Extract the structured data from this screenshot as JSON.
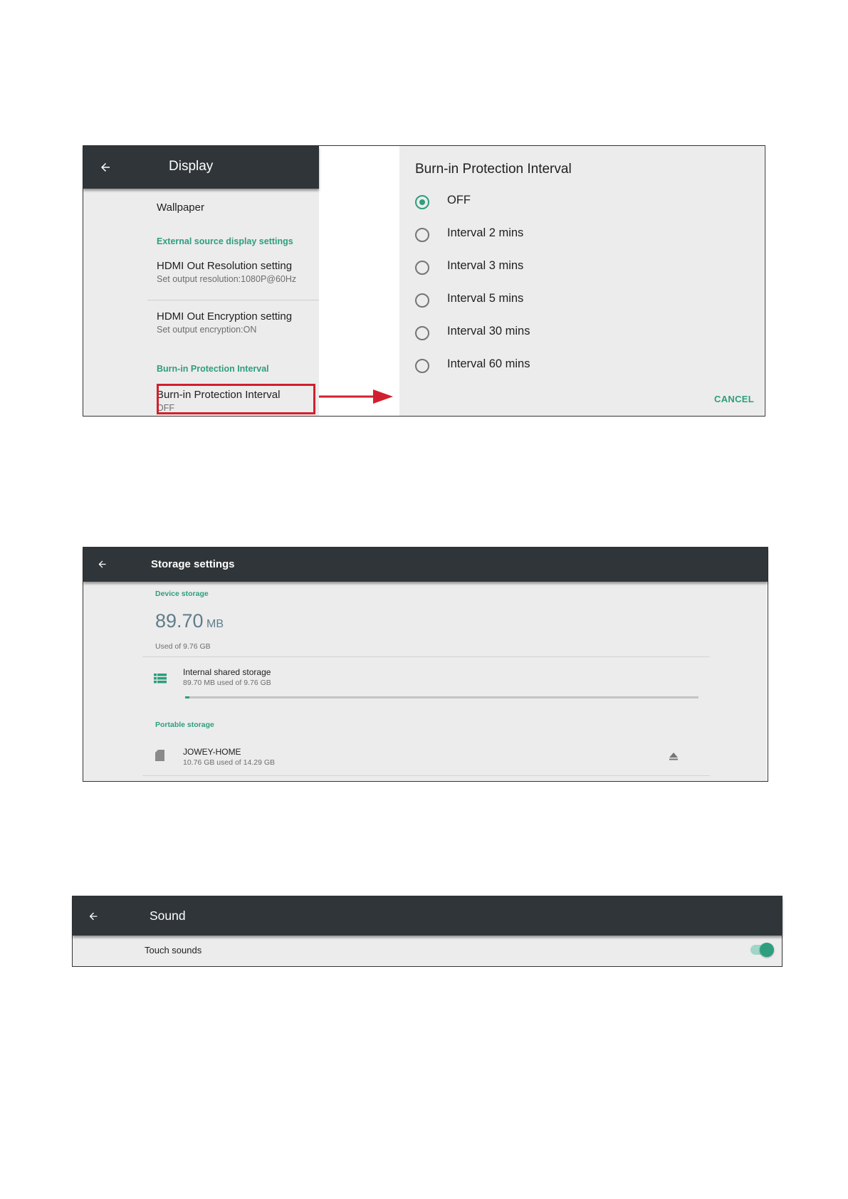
{
  "display": {
    "title": "Display",
    "wallpaper": "Wallpaper",
    "external_category": "External source display settings",
    "hdmi_res_title": "HDMI Out Resolution setting",
    "hdmi_res_sub": "Set output resolution:1080P@60Hz",
    "hdmi_enc_title": "HDMI Out Encryption setting",
    "hdmi_enc_sub": "Set output encryption:ON",
    "burn_category": "Burn-in Protection Interval",
    "burn_title": "Burn-in Protection Interval",
    "burn_sub": "OFF"
  },
  "dialog": {
    "title": "Burn-in Protection Interval",
    "options": [
      {
        "label": "OFF",
        "selected": true
      },
      {
        "label": "Interval 2 mins",
        "selected": false
      },
      {
        "label": "Interval 3 mins",
        "selected": false
      },
      {
        "label": "Interval 5 mins",
        "selected": false
      },
      {
        "label": "Interval 30 mins",
        "selected": false
      },
      {
        "label": "Interval 60 mins",
        "selected": false
      }
    ],
    "cancel": "CANCEL"
  },
  "storage": {
    "title": "Storage settings",
    "device_category": "Device storage",
    "used_value": "89.70",
    "used_unit": "MB",
    "used_of": "Used of 9.76 GB",
    "internal_title": "Internal shared storage",
    "internal_sub": "89.70 MB used of 9.76 GB",
    "internal_usage_fraction": 0.009,
    "portable_category": "Portable storage",
    "portable_title": "JOWEY-HOME",
    "portable_sub": "10.76 GB used of 14.29 GB"
  },
  "sound": {
    "title": "Sound",
    "touch_sounds": "Touch sounds",
    "touch_sounds_on": true
  },
  "colors": {
    "accent": "#2e9e7e",
    "bar": "#2f3538",
    "highlight": "#d0202e"
  }
}
